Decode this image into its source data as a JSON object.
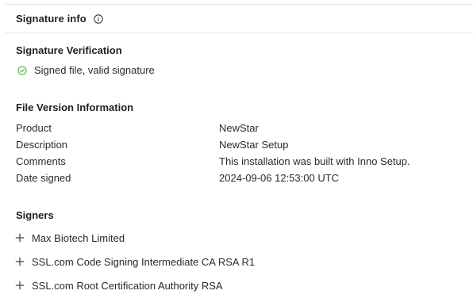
{
  "header": {
    "title": "Signature info",
    "info_icon": "info-circle-icon"
  },
  "verification": {
    "title": "Signature Verification",
    "status_text": "Signed file, valid signature",
    "status_icon": "check-circle-icon",
    "status_color": "#4caf50"
  },
  "file_version": {
    "title": "File Version Information",
    "rows": [
      {
        "key": "Product",
        "value": "NewStar"
      },
      {
        "key": "Description",
        "value": "NewStar Setup"
      },
      {
        "key": "Comments",
        "value": "This installation was built with Inno Setup."
      },
      {
        "key": "Date signed",
        "value": "2024-09-06 12:53:00 UTC"
      }
    ]
  },
  "signers": {
    "title": "Signers",
    "items": [
      {
        "label": "Max Biotech Limited",
        "icon": "plus-icon"
      },
      {
        "label": "SSL.com Code Signing Intermediate CA RSA R1",
        "icon": "plus-icon"
      },
      {
        "label": "SSL.com Root Certification Authority RSA",
        "icon": "plus-icon"
      }
    ]
  }
}
